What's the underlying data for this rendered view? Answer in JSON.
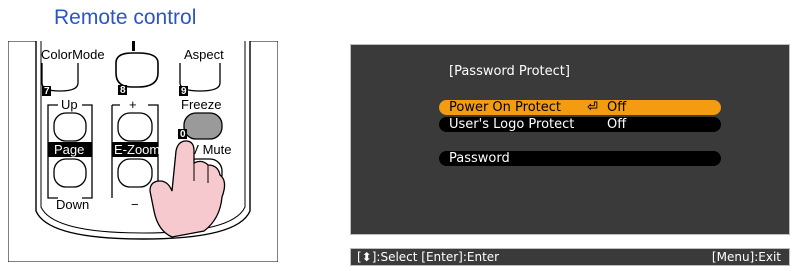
{
  "caption": "Remote control",
  "remote": {
    "buttons": {
      "color_mode": "ColorMode",
      "aspect": "Aspect",
      "up": "Up",
      "plus": "+",
      "freeze": "Freeze",
      "page": "Page",
      "e_zoom": "E-Zoom",
      "av_mute": "A/V Mute",
      "down": "Down",
      "minus": "−"
    },
    "numbers": [
      "7",
      "8",
      "9",
      "0"
    ]
  },
  "osd": {
    "title": "[Password Protect]",
    "items": [
      {
        "label": "Power On Protect",
        "value": "Off",
        "selected": true,
        "enter_icon": "⏎"
      },
      {
        "label": "User's Logo Protect",
        "value": "Off",
        "selected": false
      },
      {
        "label": "Password",
        "value": "",
        "selected": false
      }
    ],
    "status_left": "[⬍]:Select  [Enter]:Enter",
    "status_right": "[Menu]:Exit",
    "colors": {
      "selected": "#f39c12",
      "background": "#3a3a3a",
      "item": "#000000"
    }
  }
}
